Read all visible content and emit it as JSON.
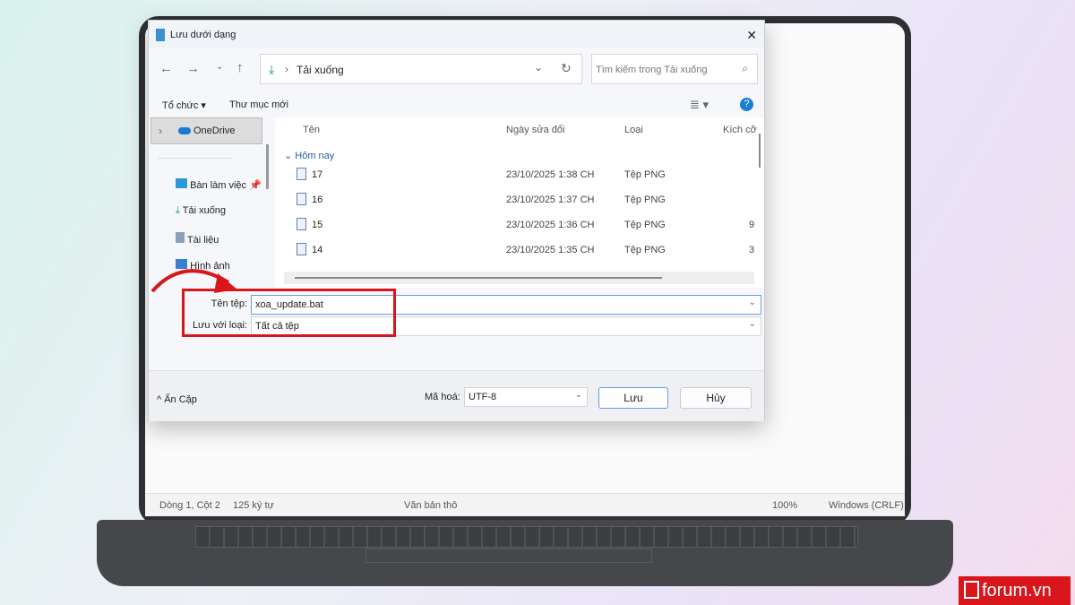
{
  "dialog": {
    "title": "Lưu dưới dạng",
    "close": "✕"
  },
  "nav": {
    "path": "Tải xuống",
    "search_placeholder": "Tìm kiếm trong Tải xuống"
  },
  "toolbar": {
    "organize": "Tổ chức",
    "new_folder": "Thư mục mới"
  },
  "sidebar": {
    "items": [
      {
        "label": "OneDrive"
      },
      {
        "label": "Bàn làm việc"
      },
      {
        "label": "Tải xuống"
      },
      {
        "label": "Tài liệu"
      },
      {
        "label": "Hình ảnh"
      }
    ]
  },
  "columns": {
    "name": "Tên",
    "date": "Ngày sửa đổi",
    "type": "Loại",
    "size": "Kích cỡ"
  },
  "group": "Hôm nay",
  "files": [
    {
      "name": "17",
      "date": "23/10/2025 1:38 CH",
      "type": "Tệp PNG",
      "size": ""
    },
    {
      "name": "16",
      "date": "23/10/2025 1:37 CH",
      "type": "Tệp PNG",
      "size": ""
    },
    {
      "name": "15",
      "date": "23/10/2025 1:36 CH",
      "type": "Tệp PNG",
      "size": "9"
    },
    {
      "name": "14",
      "date": "23/10/2025 1:35 CH",
      "type": "Tệp PNG",
      "size": "3"
    }
  ],
  "form": {
    "filename_label": "Tên tệp:",
    "filename": "xoa_update.bat",
    "type_label": "Lưu với loại:",
    "type": "Tất cả tệp",
    "encoding_label": "Mã hoá:",
    "encoding": "UTF-8",
    "save": "Lưu",
    "cancel": "Hủy",
    "hide_folders": "Ẩn Cặp"
  },
  "statusbar": {
    "position": "Dòng 1, Cột 2",
    "chars": "125 ký tự",
    "format": "Văn bản thô",
    "zoom": "100%",
    "eol": "Windows (CRLF)"
  },
  "brand": {
    "logo": "forum.vn",
    "color": "#d8161b"
  }
}
